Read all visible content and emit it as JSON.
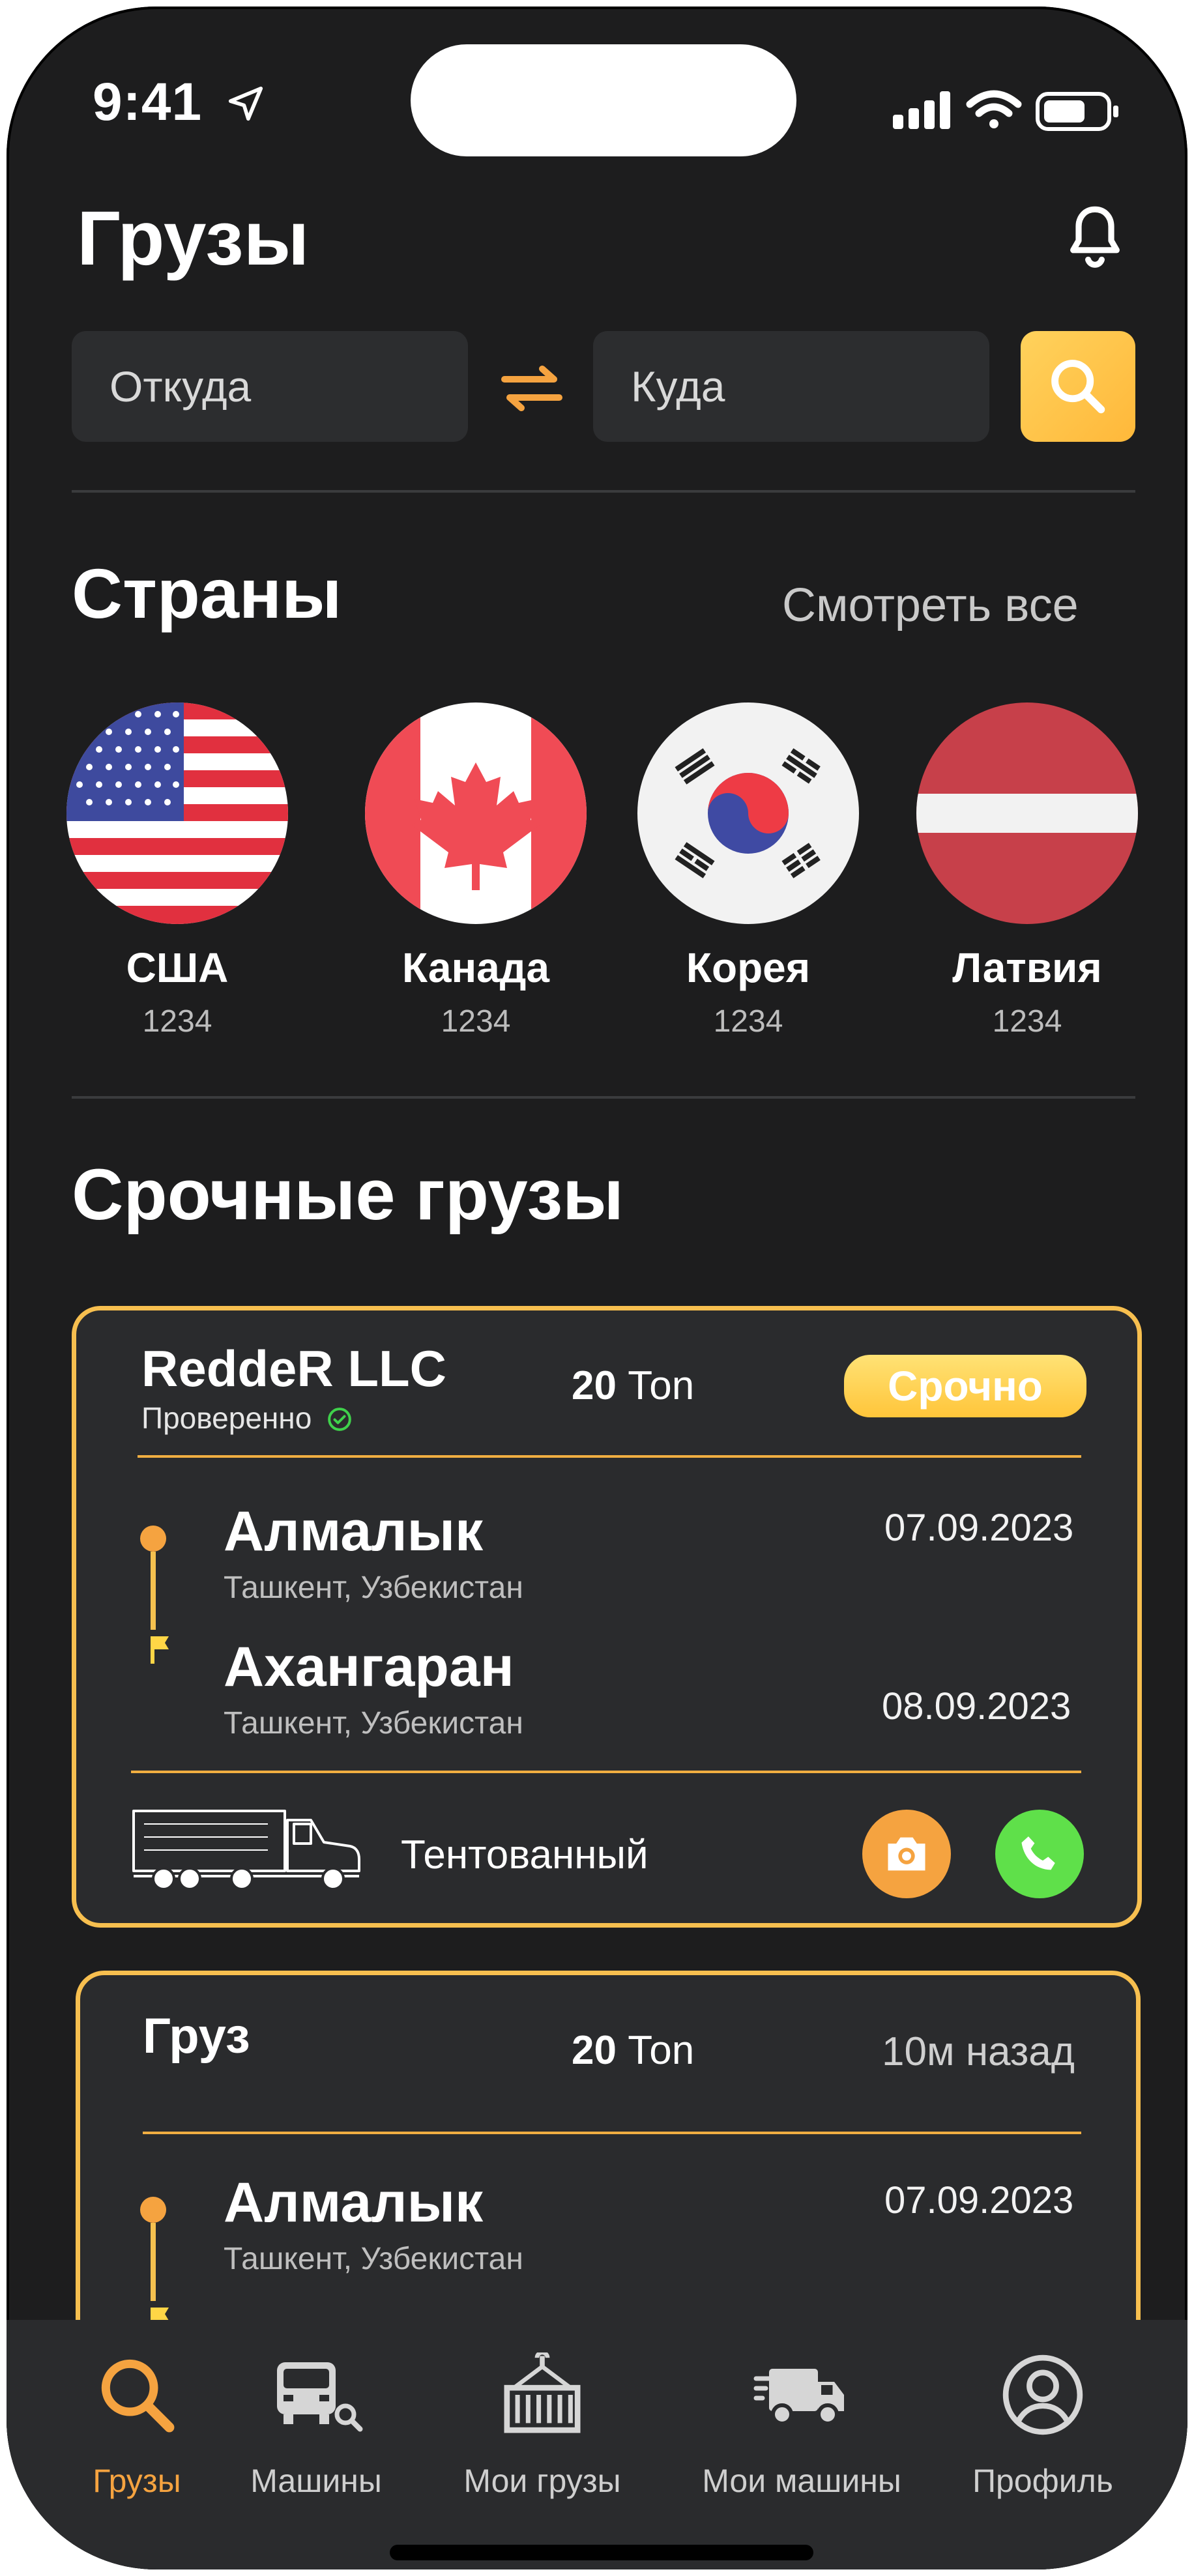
{
  "status_bar": {
    "time": "9:41"
  },
  "header": {
    "title": "Грузы"
  },
  "search": {
    "from_placeholder": "Откуда",
    "to_placeholder": "Куда"
  },
  "countries_section": {
    "title": "Страны",
    "see_all": "Смотреть все",
    "items": [
      {
        "name": "США",
        "count": "1234",
        "flag": "usa-flag"
      },
      {
        "name": "Канада",
        "count": "1234",
        "flag": "canada-flag"
      },
      {
        "name": "Корея",
        "count": "1234",
        "flag": "korea-flag"
      },
      {
        "name": "Латвия",
        "count": "1234",
        "flag": "latvia-flag"
      }
    ]
  },
  "urgent_section": {
    "title": "Срочные грузы"
  },
  "cards": [
    {
      "company": "ReddeR LLC",
      "verified_label": "Проверенно",
      "tons_value": "20",
      "tons_unit": "Тоn",
      "badge": "Срочно",
      "origin_city": "Алмалык",
      "origin_region": "Ташкент, Узбекистан",
      "origin_date": "07.09.2023",
      "dest_city": "Ахангаран",
      "dest_region": "Ташкент, Узбекистан",
      "dest_date": "08.09.2023",
      "truck_type": "Тентованный"
    },
    {
      "company": "Груз",
      "tons_value": "20",
      "tons_unit": "Тоn",
      "time_ago": "10м назад",
      "origin_city": "Алмалык",
      "origin_region": "Ташкент, Узбекистан",
      "origin_date": "07.09.2023"
    }
  ],
  "tabbar": {
    "items": [
      {
        "label": "Грузы",
        "icon": "search-icon",
        "active": true
      },
      {
        "label": "Машины",
        "icon": "truck-search-icon",
        "active": false
      },
      {
        "label": "Мои грузы",
        "icon": "container-icon",
        "active": false
      },
      {
        "label": "Мои машины",
        "icon": "delivery-truck-icon",
        "active": false
      },
      {
        "label": "Профиль",
        "icon": "profile-icon",
        "active": false
      }
    ]
  },
  "colors": {
    "background": "#1d1d1e",
    "card": "#2a2b2d",
    "accent": "#f7bf4f",
    "accent_orange": "#f5a340",
    "call_green": "#5fe04a",
    "verified_green": "#3fd14b"
  }
}
